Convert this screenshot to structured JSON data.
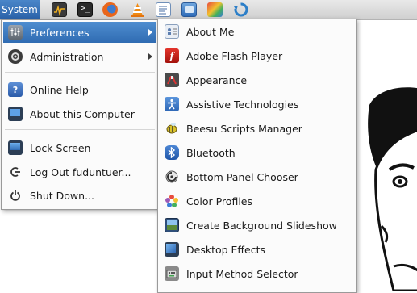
{
  "panel": {
    "system_label": "System",
    "launchers": [
      {
        "icon": "system-monitor-icon"
      },
      {
        "icon": "terminal-icon"
      },
      {
        "icon": "firefox-icon"
      },
      {
        "icon": "vlc-icon"
      },
      {
        "icon": "text-editor-icon"
      },
      {
        "icon": "desktop-window-icon"
      },
      {
        "icon": "paint-app-icon"
      },
      {
        "icon": "updater-icon"
      }
    ]
  },
  "system_menu": {
    "items": [
      {
        "label": "Preferences",
        "icon": "preferences-icon",
        "submenu": true,
        "active": true
      },
      {
        "label": "Administration",
        "icon": "administration-icon",
        "submenu": true
      },
      {
        "label": "Online Help",
        "icon": "help-icon"
      },
      {
        "label": "About this Computer",
        "icon": "computer-icon"
      },
      {
        "label": "Lock Screen",
        "icon": "lock-screen-icon"
      },
      {
        "label": "Log Out fuduntuer...",
        "icon": "log-out-icon"
      },
      {
        "label": "Shut Down...",
        "icon": "power-icon"
      }
    ]
  },
  "preferences_menu": {
    "items": [
      {
        "label": "About Me",
        "icon": "about-me-icon"
      },
      {
        "label": "Adobe Flash Player",
        "icon": "flash-icon"
      },
      {
        "label": "Appearance",
        "icon": "appearance-icon"
      },
      {
        "label": "Assistive Technologies",
        "icon": "accessibility-icon"
      },
      {
        "label": "Beesu Scripts Manager",
        "icon": "beesu-icon"
      },
      {
        "label": "Bluetooth",
        "icon": "bluetooth-icon"
      },
      {
        "label": "Bottom Panel Chooser",
        "icon": "panel-chooser-icon"
      },
      {
        "label": "Color Profiles",
        "icon": "color-profiles-icon"
      },
      {
        "label": "Create Background Slideshow",
        "icon": "slideshow-icon"
      },
      {
        "label": "Desktop Effects",
        "icon": "desktop-effects-icon"
      },
      {
        "label": "Input Method Selector",
        "icon": "input-method-icon"
      }
    ]
  }
}
